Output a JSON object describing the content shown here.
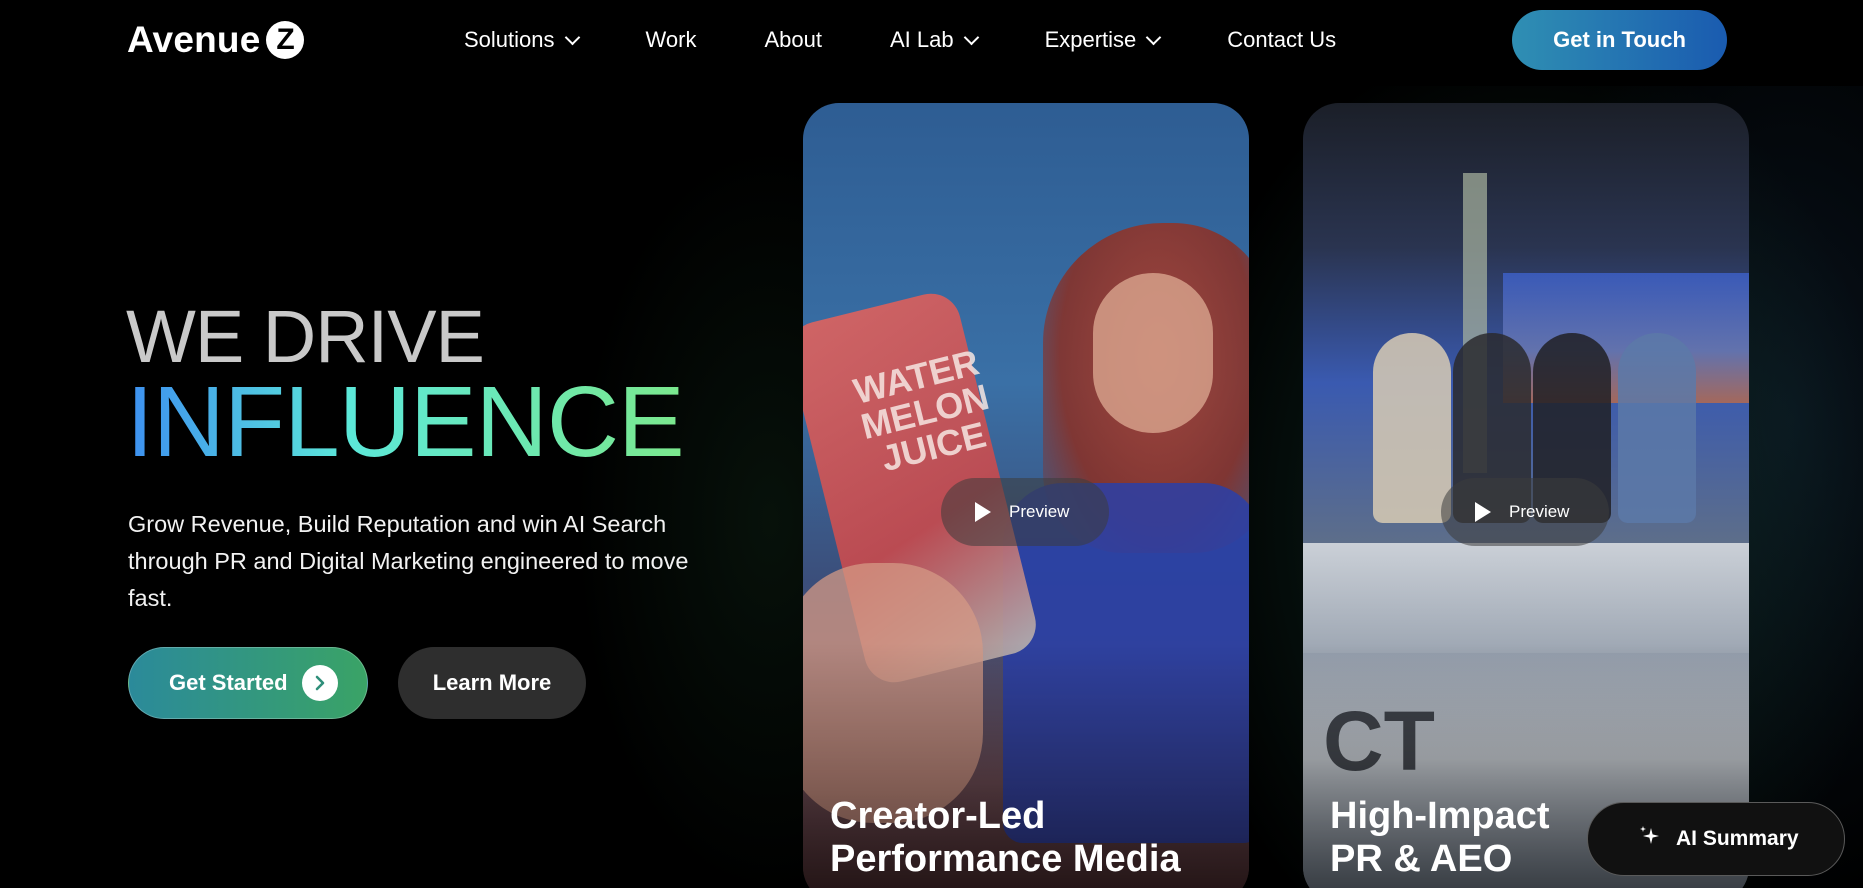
{
  "header": {
    "logo_text": "Avenue",
    "logo_badge": "Z",
    "nav": [
      {
        "label": "Solutions",
        "has_dropdown": true
      },
      {
        "label": "Work",
        "has_dropdown": false
      },
      {
        "label": "About",
        "has_dropdown": false
      },
      {
        "label": "AI Lab",
        "has_dropdown": true
      },
      {
        "label": "Expertise",
        "has_dropdown": true
      },
      {
        "label": "Contact Us",
        "has_dropdown": false
      }
    ],
    "cta_label": "Get in Touch"
  },
  "hero": {
    "line1": "WE DRIVE",
    "line2": "INFLUENCE",
    "description": "Grow Revenue, Build Reputation and win AI Search through PR and Digital Marketing engineered to move fast.",
    "primary_button": "Get Started",
    "secondary_button": "Learn More"
  },
  "cards": [
    {
      "title_line1": "Creator-Led",
      "title_line2": "Performance Media",
      "preview_label": "Preview",
      "can_text": "WATER MELON JUICE"
    },
    {
      "title_line1": "High-Impact",
      "title_line2": "PR & AEO",
      "preview_label": "Preview",
      "desk_text": "CT"
    }
  ],
  "ai_summary": {
    "label": "AI Summary"
  },
  "colors": {
    "background": "#000000",
    "cta_gradient_start": "#2f8fb3",
    "cta_gradient_end": "#1a5bb0",
    "influence_gradient": [
      "#3d8ff0",
      "#5ce8d9",
      "#7be88d"
    ],
    "get_started_gradient": [
      "#2b8a9a",
      "#3aa366"
    ]
  }
}
